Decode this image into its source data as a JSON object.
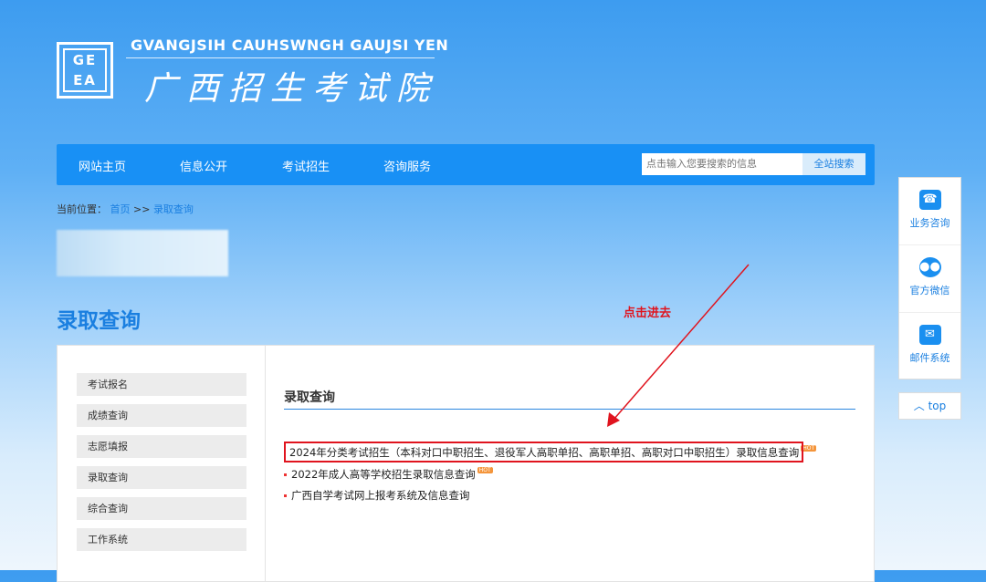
{
  "header": {
    "logo_text": "GE EA",
    "en_name": "GVANGJSIH CAUHSWNGH GAUJSI YEN",
    "cn_name": "广西招生考试院"
  },
  "nav": {
    "items": [
      "网站主页",
      "信息公开",
      "考试招生",
      "咨询服务"
    ],
    "search_placeholder": "点击输入您要搜索的信息",
    "search_button": "全站搜索"
  },
  "breadcrumb": {
    "label": "当前位置：",
    "home": "首页",
    "sep": ">>",
    "current": "录取查询"
  },
  "page_title": "录取查询",
  "sidebar": {
    "items": [
      "考试报名",
      "成绩查询",
      "志愿填报",
      "录取查询",
      "综合查询",
      "工作系统"
    ]
  },
  "content": {
    "heading": "录取查询",
    "links": [
      {
        "text": "2024年分类考试招生（本科对口中职招生、退役军人高职单招、高职单招、高职对口中职招生）录取信息查询",
        "badge": "HOT"
      },
      {
        "text": "2022年成人高等学校招生录取信息查询",
        "badge": "HOT"
      },
      {
        "text": "广西自学考试网上报考系统及信息查询"
      }
    ]
  },
  "annotation": {
    "text": "点击进去",
    "color": "#e0141e"
  },
  "right_panel": {
    "items": [
      {
        "label": "业务咨询",
        "icon": "phone-icon"
      },
      {
        "label": "官方微信",
        "icon": "wechat-icon"
      },
      {
        "label": "邮件系统",
        "icon": "mail-icon"
      }
    ],
    "top": "top"
  }
}
